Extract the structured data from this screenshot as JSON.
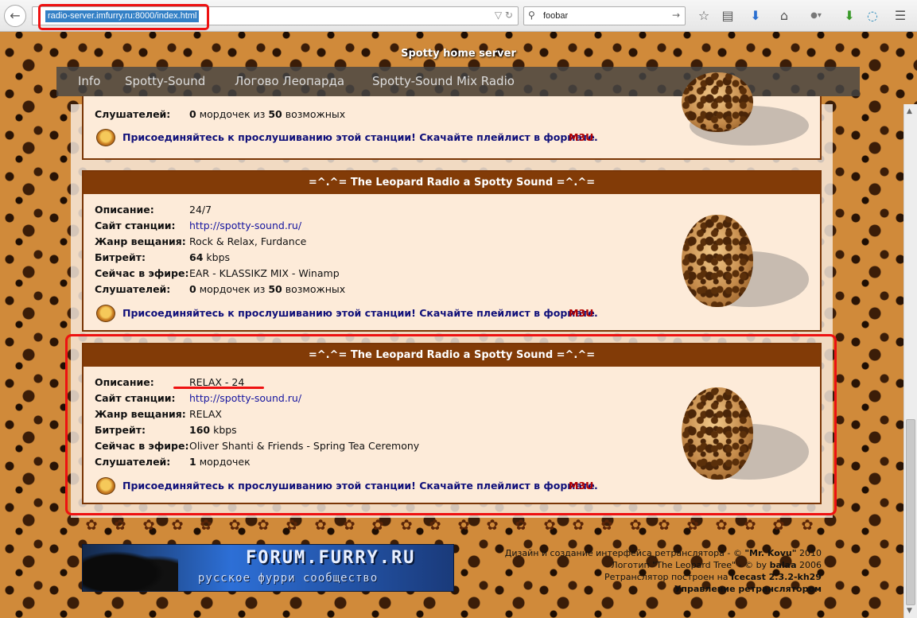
{
  "browser": {
    "url": "radio-server.imfurry.ru:8000/index.html",
    "search_text": "foobar"
  },
  "page": {
    "site_title": "Spotty home server"
  },
  "nav": {
    "items": [
      "Info",
      "Spotty-Sound",
      "Логово Леопарда",
      "Spotty-Sound Mix Radio"
    ]
  },
  "top_partial": {
    "listeners_label": "Слушателей:",
    "listeners_value": "0",
    "listeners_mid": "мордочек из",
    "listeners_max": "50",
    "listeners_suffix": "возможных",
    "join_text": "Присоединяйтесь к прослушиванию этой станции! Скачайте плейлист в формате",
    "m3u": "M3U"
  },
  "stations": [
    {
      "header": "=^.^= The Leopard Radio a Spotty Sound =^.^=",
      "desc_label": "Описание:",
      "desc": "24/7",
      "site_label": "Сайт станции:",
      "site": "http://spotty-sound.ru/",
      "genre_label": "Жанр вещания:",
      "genre": "Rock & Relax, Furdance",
      "bitrate_label": "Битрейт:",
      "bitrate_value": "64",
      "bitrate_unit": "kbps",
      "now_label": "Сейчас в эфире:",
      "now": "EAR - KLASSIKZ MIX - Winamp",
      "listeners_label": "Слушателей:",
      "listeners_value": "0",
      "listeners_mid": "мордочек из",
      "listeners_max": "50",
      "listeners_suffix": "возможных",
      "join_text": "Присоединяйтесь к прослушиванию этой станции! Скачайте плейлист в формате",
      "m3u": "M3U"
    },
    {
      "header": "=^.^= The Leopard Radio a Spotty Sound =^.^=",
      "desc_label": "Описание:",
      "desc": "RELAX - 24",
      "site_label": "Сайт станции:",
      "site": "http://spotty-sound.ru/",
      "genre_label": "Жанр вещания:",
      "genre": "RELAX",
      "bitrate_label": "Битрейт:",
      "bitrate_value": "160",
      "bitrate_unit": "kbps",
      "now_label": "Сейчас в эфире:",
      "now": "Oliver Shanti & Friends - Spring Tea Ceremony",
      "listeners_label": "Слушателей:",
      "listeners_value": "1",
      "listeners_mid": "мордочек",
      "join_text": "Присоединяйтесь к прослушиванию этой станции! Скачайте плейлист в формате",
      "m3u": "M3U"
    }
  ],
  "footer": {
    "banner_title": "FORUM.FURRY.RU",
    "banner_sub": "русское фурри сообщество",
    "credit1_pre": "Дизайн и создание интерфейса ретранслятора - ©",
    "credit1_name": "\"Mr. Kovu\"",
    "credit1_year": "2010",
    "credit2_pre": "Логотип \"The Leopard Tree\" - © by",
    "credit2_name": "balaa",
    "credit2_year": "2006",
    "credit3_pre": "Ретранслятор построен на",
    "credit3_name": "Icecast 2.3.2-kh29",
    "admin_link": "Управление ретранслятором"
  },
  "icons": {
    "back": "back-arrow-icon",
    "bookmark": "star-icon",
    "download": "download-arrow-icon",
    "home": "home-icon",
    "menu": "hamburger-menu-icon"
  },
  "colors": {
    "station_header": "#823b07",
    "link": "#1515a0",
    "join": "#10107a",
    "m3u": "#b30000",
    "highlight": "#e11111"
  }
}
